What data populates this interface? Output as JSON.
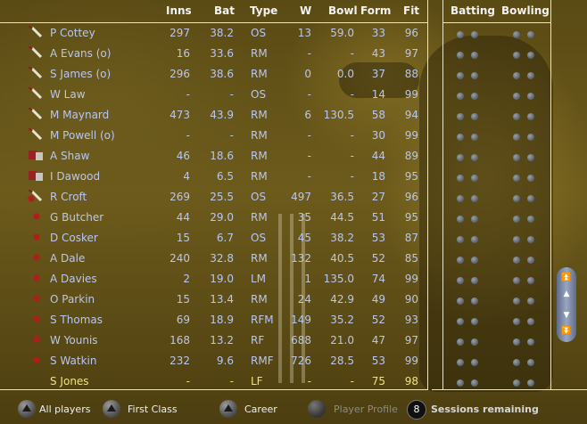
{
  "columns": {
    "inns": "Inns",
    "bat": "Bat",
    "type": "Type",
    "w": "W",
    "bowl": "Bowl",
    "form": "Form",
    "fit": "Fit",
    "batting": "Batting",
    "bowling": "Bowling"
  },
  "colors": {
    "text": "#b9c6ee",
    "selected_text": "#f0e37a",
    "header_text": "#f2f2f2",
    "background": "#5a4a14"
  },
  "players": [
    {
      "name": "P Cottey",
      "inns": "297",
      "bat": "38.2",
      "type": "OS",
      "w": "13",
      "bowl": "59.0",
      "form": "33",
      "fit": "96",
      "icon": "bat-icon"
    },
    {
      "name": "A Evans (o)",
      "inns": "16",
      "bat": "33.6",
      "type": "RM",
      "w": "-",
      "bowl": "-",
      "form": "43",
      "fit": "97",
      "icon": "bat-icon"
    },
    {
      "name": "S James (o)",
      "inns": "296",
      "bat": "38.6",
      "type": "RM",
      "w": "0",
      "bowl": "0.0",
      "form": "37",
      "fit": "88",
      "icon": "bat-icon"
    },
    {
      "name": "W Law",
      "inns": "-",
      "bat": "-",
      "type": "OS",
      "w": "-",
      "bowl": "-",
      "form": "14",
      "fit": "99",
      "icon": "bat-icon"
    },
    {
      "name": "M Maynard",
      "inns": "473",
      "bat": "43.9",
      "type": "RM",
      "w": "6",
      "bowl": "130.5",
      "form": "58",
      "fit": "94",
      "icon": "bat-icon"
    },
    {
      "name": "M Powell (o)",
      "inns": "-",
      "bat": "-",
      "type": "RM",
      "w": "-",
      "bowl": "-",
      "form": "30",
      "fit": "99",
      "icon": "bat-icon"
    },
    {
      "name": "A Shaw",
      "inns": "46",
      "bat": "18.6",
      "type": "RM",
      "w": "-",
      "bowl": "-",
      "form": "44",
      "fit": "89",
      "icon": "keeper-icon"
    },
    {
      "name": "I Dawood",
      "inns": "4",
      "bat": "6.5",
      "type": "RM",
      "w": "-",
      "bowl": "-",
      "form": "18",
      "fit": "95",
      "icon": "keeper-icon"
    },
    {
      "name": "R Croft",
      "inns": "269",
      "bat": "25.5",
      "type": "OS",
      "w": "497",
      "bowl": "36.5",
      "form": "27",
      "fit": "96",
      "icon": "allrounder-icon"
    },
    {
      "name": "G Butcher",
      "inns": "44",
      "bat": "29.0",
      "type": "RM",
      "w": "35",
      "bowl": "44.5",
      "form": "51",
      "fit": "95",
      "icon": "ball-icon"
    },
    {
      "name": "D Cosker",
      "inns": "15",
      "bat": "6.7",
      "type": "OS",
      "w": "45",
      "bowl": "38.2",
      "form": "53",
      "fit": "87",
      "icon": "ball-icon"
    },
    {
      "name": "A Dale",
      "inns": "240",
      "bat": "32.8",
      "type": "RM",
      "w": "132",
      "bowl": "40.5",
      "form": "52",
      "fit": "85",
      "icon": "ball-icon"
    },
    {
      "name": "A Davies",
      "inns": "2",
      "bat": "19.0",
      "type": "LM",
      "w": "1",
      "bowl": "135.0",
      "form": "74",
      "fit": "99",
      "icon": "ball-icon"
    },
    {
      "name": "O Parkin",
      "inns": "15",
      "bat": "13.4",
      "type": "RM",
      "w": "24",
      "bowl": "42.9",
      "form": "49",
      "fit": "90",
      "icon": "ball-icon"
    },
    {
      "name": "S Thomas",
      "inns": "69",
      "bat": "18.9",
      "type": "RFM",
      "w": "149",
      "bowl": "35.2",
      "form": "52",
      "fit": "93",
      "icon": "ball-icon"
    },
    {
      "name": "W Younis",
      "inns": "168",
      "bat": "13.2",
      "type": "RF",
      "w": "688",
      "bowl": "21.0",
      "form": "47",
      "fit": "97",
      "icon": "ball-icon"
    },
    {
      "name": "S Watkin",
      "inns": "232",
      "bat": "9.6",
      "type": "RMF",
      "w": "726",
      "bowl": "28.5",
      "form": "53",
      "fit": "99",
      "icon": "ball-icon"
    },
    {
      "name": "S Jones",
      "inns": "-",
      "bat": "-",
      "type": "LF",
      "w": "-",
      "bowl": "-",
      "form": "75",
      "fit": "98",
      "icon": "none",
      "selected": true
    }
  ],
  "bottom_bar": {
    "all_players": "All players",
    "first_class": "First Class",
    "career": "Career",
    "player_profile": "Player Profile",
    "sessions_count": "8",
    "sessions_label": "Sessions remaining"
  },
  "scrollbar": {
    "up_fast": "⏫",
    "up": "▲",
    "down": "▼",
    "down_fast": "⏬"
  }
}
